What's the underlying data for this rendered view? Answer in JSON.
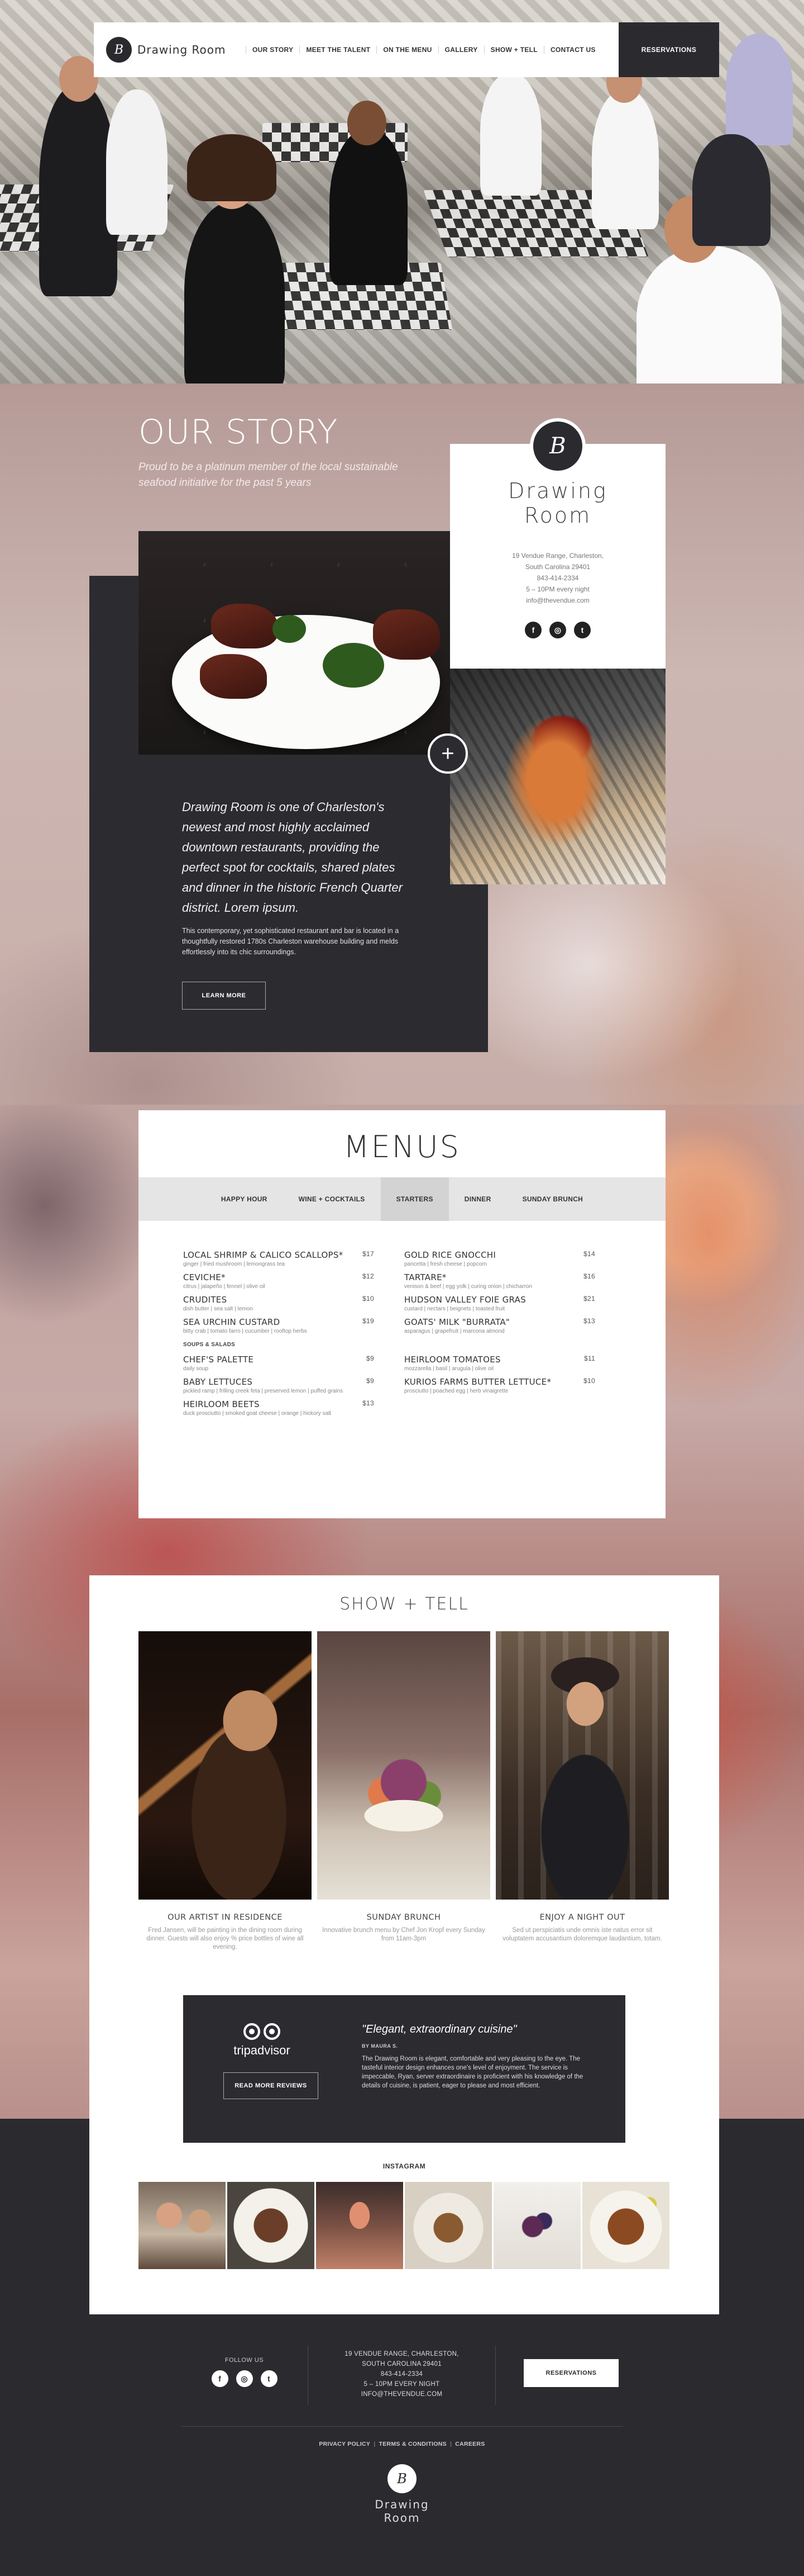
{
  "nav": {
    "logo_text": "Drawing Room",
    "items": [
      "OUR STORY",
      "MEET THE TALENT",
      "ON THE MENU",
      "GALLERY",
      "SHOW + TELL",
      "CONTACT US"
    ],
    "reservations": "RESERVATIONS"
  },
  "story": {
    "title": "OUR STORY",
    "subtitle": "Proud to be a platinum member of the local sustainable seafood initiative for the past 5 years",
    "lead": "Drawing Room is one of Charleston's newest and most highly acclaimed downtown restaurants, providing the perfect spot for cocktails, shared plates and dinner in the historic French Quarter district. Lorem ipsum.",
    "body": "This contemporary, yet sophisticated restaurant and bar is located in a thoughtfully restored 1780s Charleston warehouse building and melds effortlessly into its chic surroundings.",
    "button": "LEARN MORE",
    "plus": "+"
  },
  "card": {
    "name_line1": "Drawing",
    "name_line2": "Room",
    "address1": "19 Vendue Range, Charleston,",
    "address2": "South Carolina 29401",
    "phone": "843-414-2334",
    "hours": "5 – 10PM every night",
    "email": "info@thevendue.com"
  },
  "menus": {
    "title": "MENUS",
    "tabs": [
      "HAPPY HOUR",
      "WINE + COCKTAILS",
      "STARTERS",
      "DINNER",
      "SUNDAY BRUNCH"
    ],
    "active_tab": "STARTERS",
    "left": [
      {
        "name": "LOCAL SHRIMP & CALICO SCALLOPS*",
        "price": "$17",
        "desc": "ginger | fried mushroom | lemongrass tea"
      },
      {
        "name": "CEVICHE*",
        "price": "$12",
        "desc": "citrus | jalapeño | fennel | olive oil"
      },
      {
        "name": "CRUDITES",
        "price": "$10",
        "desc": "dish butter | sea salt | lemon"
      },
      {
        "name": "SEA URCHIN CUSTARD",
        "price": "$19",
        "desc": "bitty crab | tomato farro | cucumber | rooftop herbs"
      }
    ],
    "soups_heading": "SOUPS & SALADS",
    "left2": [
      {
        "name": "CHEF'S PALETTE",
        "price": "$9",
        "desc": "daily soup"
      },
      {
        "name": "BABY LETTUCES",
        "price": "$9",
        "desc": "pickled ramp | frilling creek feta | preserved lemon | puffed grains"
      },
      {
        "name": "HEIRLOOM BEETS",
        "price": "$13",
        "desc": "duck prosciutto | smoked goat cheese | orange | hickory salt"
      }
    ],
    "right": [
      {
        "name": "GOLD RICE GNOCCHI",
        "price": "$14",
        "desc": "pancetta | fresh cheese | popcorn"
      },
      {
        "name": "TARTARE*",
        "price": "$16",
        "desc": "venison & beef | egg yolk | curing onion | chicharron"
      },
      {
        "name": "HUDSON VALLEY FOIE GRAS",
        "price": "$21",
        "desc": "custard | nectars | beignets | toasted fruit"
      },
      {
        "name": "GOATS' MILK \"BURRATA\"",
        "price": "$13",
        "desc": "asparagus | grapefruit | marcona almond"
      }
    ],
    "right2": [
      {
        "name": "HEIRLOOM TOMATOES",
        "price": "$11",
        "desc": "mozzarella | basil | arugula | olive oil"
      },
      {
        "name": "KURIOS FARMS BUTTER LETTUCE*",
        "price": "$10",
        "desc": "prosciutto | poached egg | herb vinaigrette"
      }
    ]
  },
  "show": {
    "title": "SHOW + TELL",
    "items": [
      {
        "title": "OUR ARTIST IN RESIDENCE",
        "text": "Fred Jansen, will be painting in the dining room during dinner. Guests will also enjoy % price bottles of wine all evening."
      },
      {
        "title": "SUNDAY BRUNCH",
        "text": "Innovative brunch menu by Chef Jon Kropf every Sunday from 11am-3pm"
      },
      {
        "title": "ENJOY A NIGHT OUT",
        "text": "Sed ut perspiciatis unde omnis iste natus error sit voluptatem accusantium doloremque laudantium, totam."
      }
    ]
  },
  "review": {
    "brand": "tripadvisor",
    "button": "READ MORE REVIEWS",
    "quote": "\"Elegant, extraordinary cuisine\"",
    "by": "BY MAURA S.",
    "text": "The Drawing Room is elegant, comfortable and very pleasing to the eye. The tasteful interior design enhances one's level of enjoyment. The service is impeccable, Ryan, server extraordinaire is proficient with his knowledge of the details of cuisine, is patient, eager to please and most efficient."
  },
  "instagram": {
    "label": "INSTAGRAM"
  },
  "footer": {
    "follow": "FOLLOW US",
    "address1": "19 VENDUE RANGE, CHARLESTON,",
    "address2": "SOUTH CAROLINA 29401",
    "phone": "843-414-2334",
    "hours": "5 – 10PM EVERY NIGHT",
    "email": "INFO@THEVENDUE.COM",
    "reservations": "RESERVATIONS",
    "links": [
      "PRIVACY POLICY",
      "TERMS & CONDITIONS",
      "CAREERS"
    ],
    "logo_line1": "Drawing",
    "logo_line2": "Room"
  },
  "social": {
    "facebook": "f",
    "instagram": "◎",
    "twitter": "t"
  },
  "logo_glyph": "B",
  "colors": {
    "dark": "#2b2a2f",
    "accent_bg": "#c9aaa6"
  }
}
